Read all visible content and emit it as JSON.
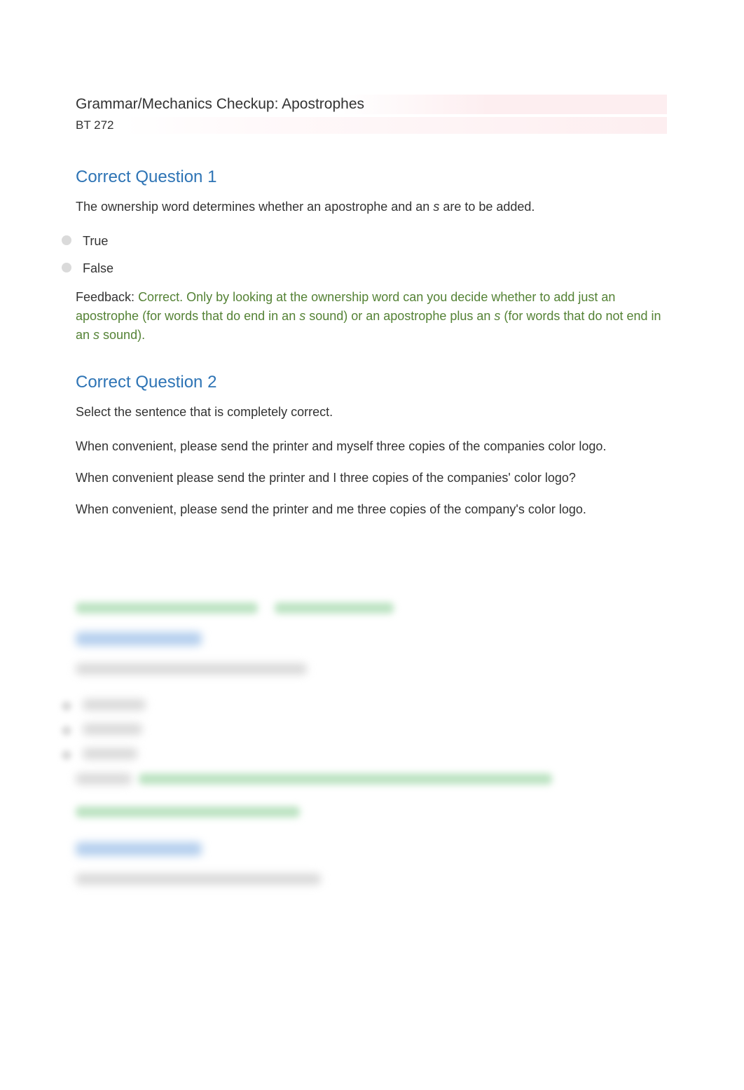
{
  "doc": {
    "title": "Grammar/Mechanics Checkup: Apostrophes",
    "subtitle": "BT 272"
  },
  "q1": {
    "heading": "Correct Question 1",
    "prompt_pre": "The ownership word determines whether an apostrophe and an ",
    "prompt_italic": "s",
    "prompt_post": " are to be added.",
    "opt_true": "True",
    "opt_false": "False",
    "feedback_label": "Feedback: ",
    "feedback_pre": "Correct. Only by looking at the ownership word can you decide whether to add just an apostrophe (for words that do end in an ",
    "feedback_italic1": "s",
    "feedback_mid": " sound) or an apostrophe plus an ",
    "feedback_italic2": "s",
    "feedback_post": " (for words that do not end in an ",
    "feedback_italic3": "s",
    "feedback_tail": " sound)."
  },
  "q2": {
    "heading": "Correct Question 2",
    "prompt": "Select the sentence that is completely correct.",
    "opt_a": "When convenient, please send the printer and myself three copies of the companies color logo.",
    "opt_b": "When convenient please send the printer and I three copies of the companies' color logo?",
    "opt_c": "When convenient, please send the printer and me three copies of the company's color logo."
  }
}
